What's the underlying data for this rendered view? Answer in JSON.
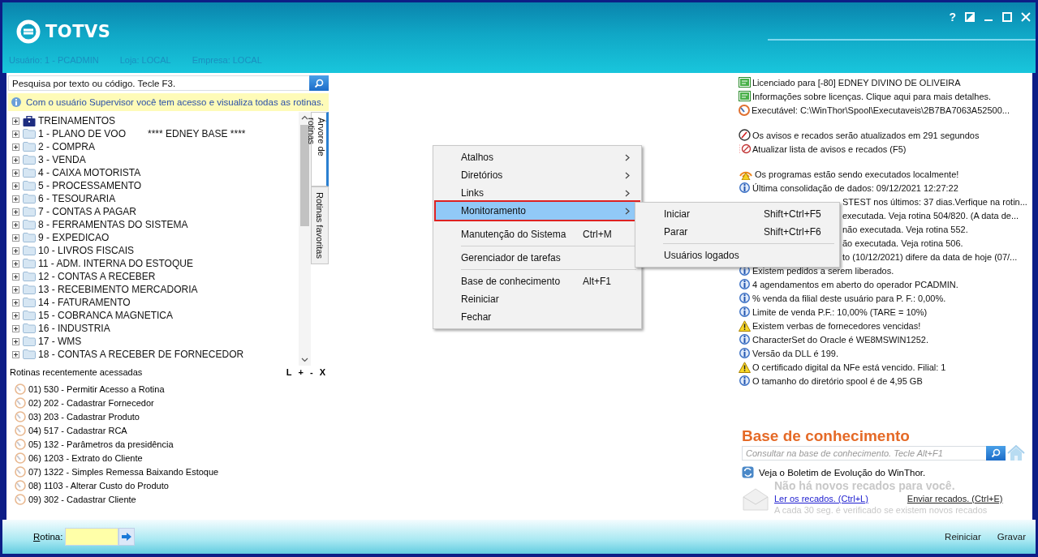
{
  "header": {
    "logo": "TOTVS",
    "window_controls": [
      "?"
    ],
    "user_info": [
      "Usuário: 1 - PCADMIN",
      "Loja: LOCAL",
      "Empresa: LOCAL"
    ]
  },
  "search": {
    "placeholder": "Pesquisa por texto ou código. Tecle F3."
  },
  "info_bar": "Com o usuário Supervisor você tem acesso e visualiza todas as rotinas.",
  "tree": [
    {
      "kind": "case",
      "label": "TREINAMENTOS",
      "expanded": false
    },
    {
      "kind": "folder",
      "label": "1 - PLANO DE VOO",
      "note": "**** EDNEY BASE ****",
      "expanded": false
    },
    {
      "kind": "folder",
      "label": "2 - COMPRA",
      "expanded": false
    },
    {
      "kind": "folder",
      "label": "3 - VENDA",
      "expanded": false
    },
    {
      "kind": "folder",
      "label": "4 - CAIXA MOTORISTA",
      "expanded": false
    },
    {
      "kind": "folder",
      "label": "5 - PROCESSAMENTO",
      "expanded": false
    },
    {
      "kind": "folder",
      "label": "6 - TESOURARIA",
      "expanded": false
    },
    {
      "kind": "folder",
      "label": "7 - CONTAS A PAGAR",
      "expanded": false
    },
    {
      "kind": "folder",
      "label": "8 - FERRAMENTAS DO SISTEMA",
      "expanded": false
    },
    {
      "kind": "folder",
      "label": "9 - EXPEDICAO",
      "expanded": false
    },
    {
      "kind": "folder",
      "label": "10 - LIVROS FISCAIS",
      "expanded": false
    },
    {
      "kind": "folder",
      "label": "11 - ADM. INTERNA DO ESTOQUE",
      "expanded": false
    },
    {
      "kind": "folder",
      "label": "12 - CONTAS A RECEBER",
      "expanded": false
    },
    {
      "kind": "folder",
      "label": "13 - RECEBIMENTO MERCADORIA",
      "expanded": false
    },
    {
      "kind": "folder",
      "label": "14 - FATURAMENTO",
      "expanded": false
    },
    {
      "kind": "folder",
      "label": "15 - COBRANCA MAGNETICA",
      "expanded": false
    },
    {
      "kind": "folder",
      "label": "16 - INDUSTRIA",
      "expanded": false
    },
    {
      "kind": "folder",
      "label": "17 - WMS",
      "expanded": false
    },
    {
      "kind": "folder",
      "label": "18 - CONTAS A RECEBER DE FORNECEDOR",
      "expanded": false
    }
  ],
  "side_tabs": [
    {
      "label": "Árvore de rotinas",
      "selected": true
    },
    {
      "label": "Rotinas favoritas",
      "selected": false
    }
  ],
  "recent": {
    "title": "Rotinas recentemente acessadas",
    "actions": [
      "L",
      "+",
      "-",
      "X"
    ],
    "items": [
      "01)  530 - Permitir Acesso a Rotina",
      "02)  202 - Cadastrar  Fornecedor",
      "03)  203 - Cadastrar  Produto",
      "04)  517 - Cadastrar RCA",
      "05)  132 - Parâmetros da presidência",
      "06)  1203 - Extrato do Cliente",
      "07)  1322 - Simples Remessa Baixando Estoque",
      "08)  1103 - Alterar Custo do Produto",
      "09)  302 - Cadastrar Cliente"
    ]
  },
  "message_groups": [
    [
      {
        "kind": "license",
        "text": "Licenciado para [-80] EDNEY DIVINO DE OLIVEIRA"
      },
      {
        "kind": "license",
        "text": "Informações sobre licenças. Clique aqui para mais detalhes."
      },
      {
        "kind": "exe",
        "text": "Executável: C:\\WinThor\\Spool\\Executaveis\\2B7BA7063A52500..."
      }
    ],
    [
      {
        "kind": "timer",
        "text": "Os avisos e recados serão atualizados em 291 segundos"
      },
      {
        "kind": "refresh",
        "text": "Atualizar lista de avisos e recados (F5)"
      }
    ],
    [
      {
        "kind": "signal",
        "text": "Os programas estão sendo executados localmente!"
      },
      {
        "kind": "info",
        "text": "Última consolidação de dados: 09/12/2021 12:27:22"
      },
      {
        "kind": "covered",
        "text": "STEST nos últimos: 37 dias.Verfique na rotin..."
      },
      {
        "kind": "covered",
        "text": "executada. Veja rotina 504/820. (A data de..."
      },
      {
        "kind": "covered",
        "text": "não executada. Veja rotina 552."
      },
      {
        "kind": "covered",
        "text": "ão executada. Veja rotina 506."
      },
      {
        "kind": "covered",
        "text": "to (10/12/2021) difere da data de hoje (07/..."
      },
      {
        "kind": "info",
        "text": "Existem pedidos a serem liberados."
      },
      {
        "kind": "info",
        "text": "4 agendamentos em aberto do operador PCADMIN."
      },
      {
        "kind": "info",
        "text": "% venda da filial deste usuário para P. F.: 0,00%."
      },
      {
        "kind": "info",
        "text": "Limite de venda P.F.: 10,00% (TARE = 10%)"
      },
      {
        "kind": "warning",
        "text": "Existem verbas de fornecedores vencidas!"
      },
      {
        "kind": "info",
        "text": "CharacterSet do Oracle é WE8MSWIN1252."
      },
      {
        "kind": "info",
        "text": "Versão da DLL é 199."
      },
      {
        "kind": "warning",
        "text": "O certificado digital da NFe está vencido. Filial: 1"
      },
      {
        "kind": "info",
        "text": "O tamanho do diretório spool é de 4,95 GB"
      }
    ]
  ],
  "knowledge_base": {
    "title": "Base de conhecimento",
    "placeholder": "Consultar na base de conhecimento. Tecle Alt+F1",
    "bulletin": "Veja o Boletim de Evolução do WinThor.",
    "no_messages": "Não há novos recados para você.",
    "read_link": "Ler os recados. (Ctrl+L)",
    "send_link": "Enviar recados. (Ctrl+E)",
    "note": "A cada 30 seg. é verificado se existem novos recados"
  },
  "context_menu": [
    {
      "label": "Atalhos",
      "submenu": true,
      "selected": false,
      "separator_after": false
    },
    {
      "label": "Diretórios",
      "submenu": true,
      "selected": false,
      "separator_after": false
    },
    {
      "label": "Links",
      "submenu": true,
      "selected": false,
      "separator_after": false
    },
    {
      "label": "Monitoramento",
      "submenu": true,
      "selected": true,
      "separator_after": true
    },
    {
      "label": "Manutenção do Sistema",
      "shortcut": "Ctrl+M",
      "submenu": false,
      "selected": false,
      "separator_after": true
    },
    {
      "label": "Gerenciador de tarefas",
      "submenu": false,
      "selected": false,
      "separator_after": true
    },
    {
      "label": "Base de conhecimento",
      "shortcut": "Alt+F1",
      "submenu": false,
      "selected": false,
      "separator_after": false
    },
    {
      "label": "Reiniciar",
      "submenu": false,
      "selected": false,
      "separator_after": false
    },
    {
      "label": "Fechar",
      "submenu": false,
      "selected": false,
      "separator_after": false
    }
  ],
  "submenu": [
    {
      "label": "Iniciar",
      "shortcut": "Shift+Ctrl+F5",
      "separator_after": false
    },
    {
      "label": "Parar",
      "shortcut": "Shift+Ctrl+F6",
      "separator_after": true
    },
    {
      "label": "Usuários logados",
      "separator_after": false
    }
  ],
  "bottom_bar": {
    "rotina_label": "Rotina:",
    "buttons": [
      "Reiniciar",
      "Gravar"
    ]
  }
}
